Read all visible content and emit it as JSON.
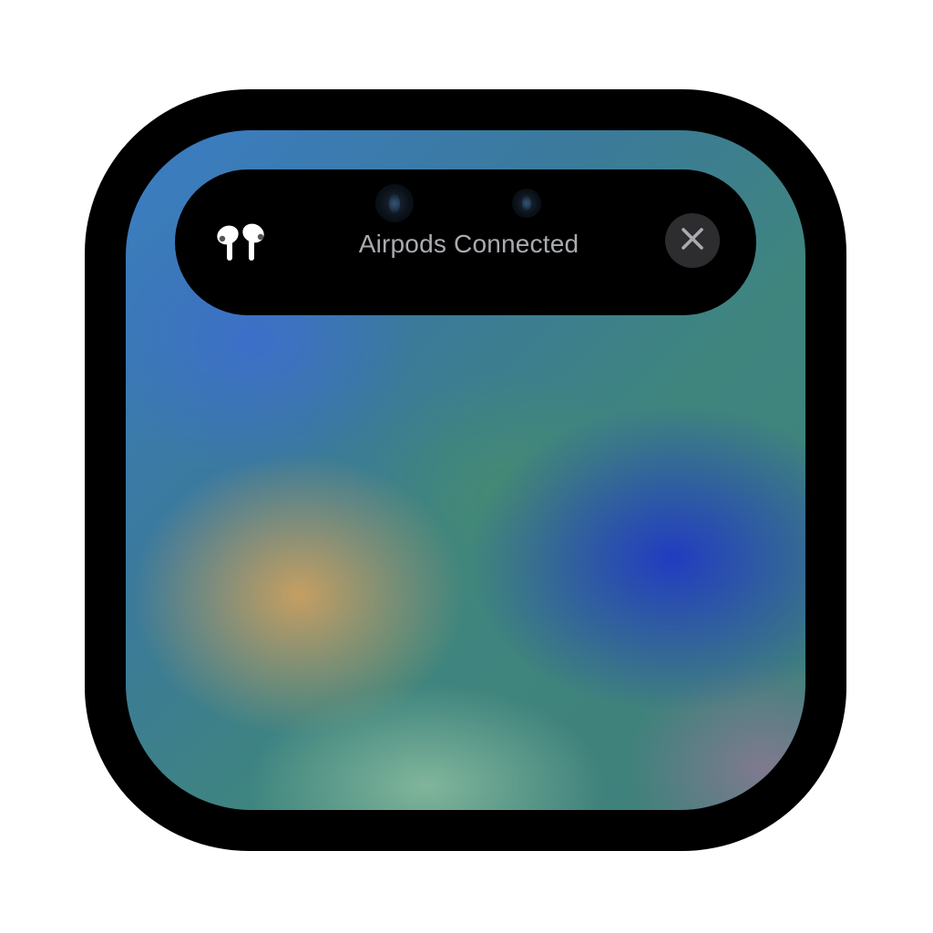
{
  "notification": {
    "title": "Airpods Connected",
    "device_icon": "airpods-icon",
    "close_icon": "close-icon"
  },
  "colors": {
    "frame": "#000000",
    "island": "#000000",
    "title_text": "#a9abb0",
    "close_button_bg": "#2d2d2f",
    "close_icon": "#a9abb0",
    "airpods_icon": "#ffffff"
  }
}
